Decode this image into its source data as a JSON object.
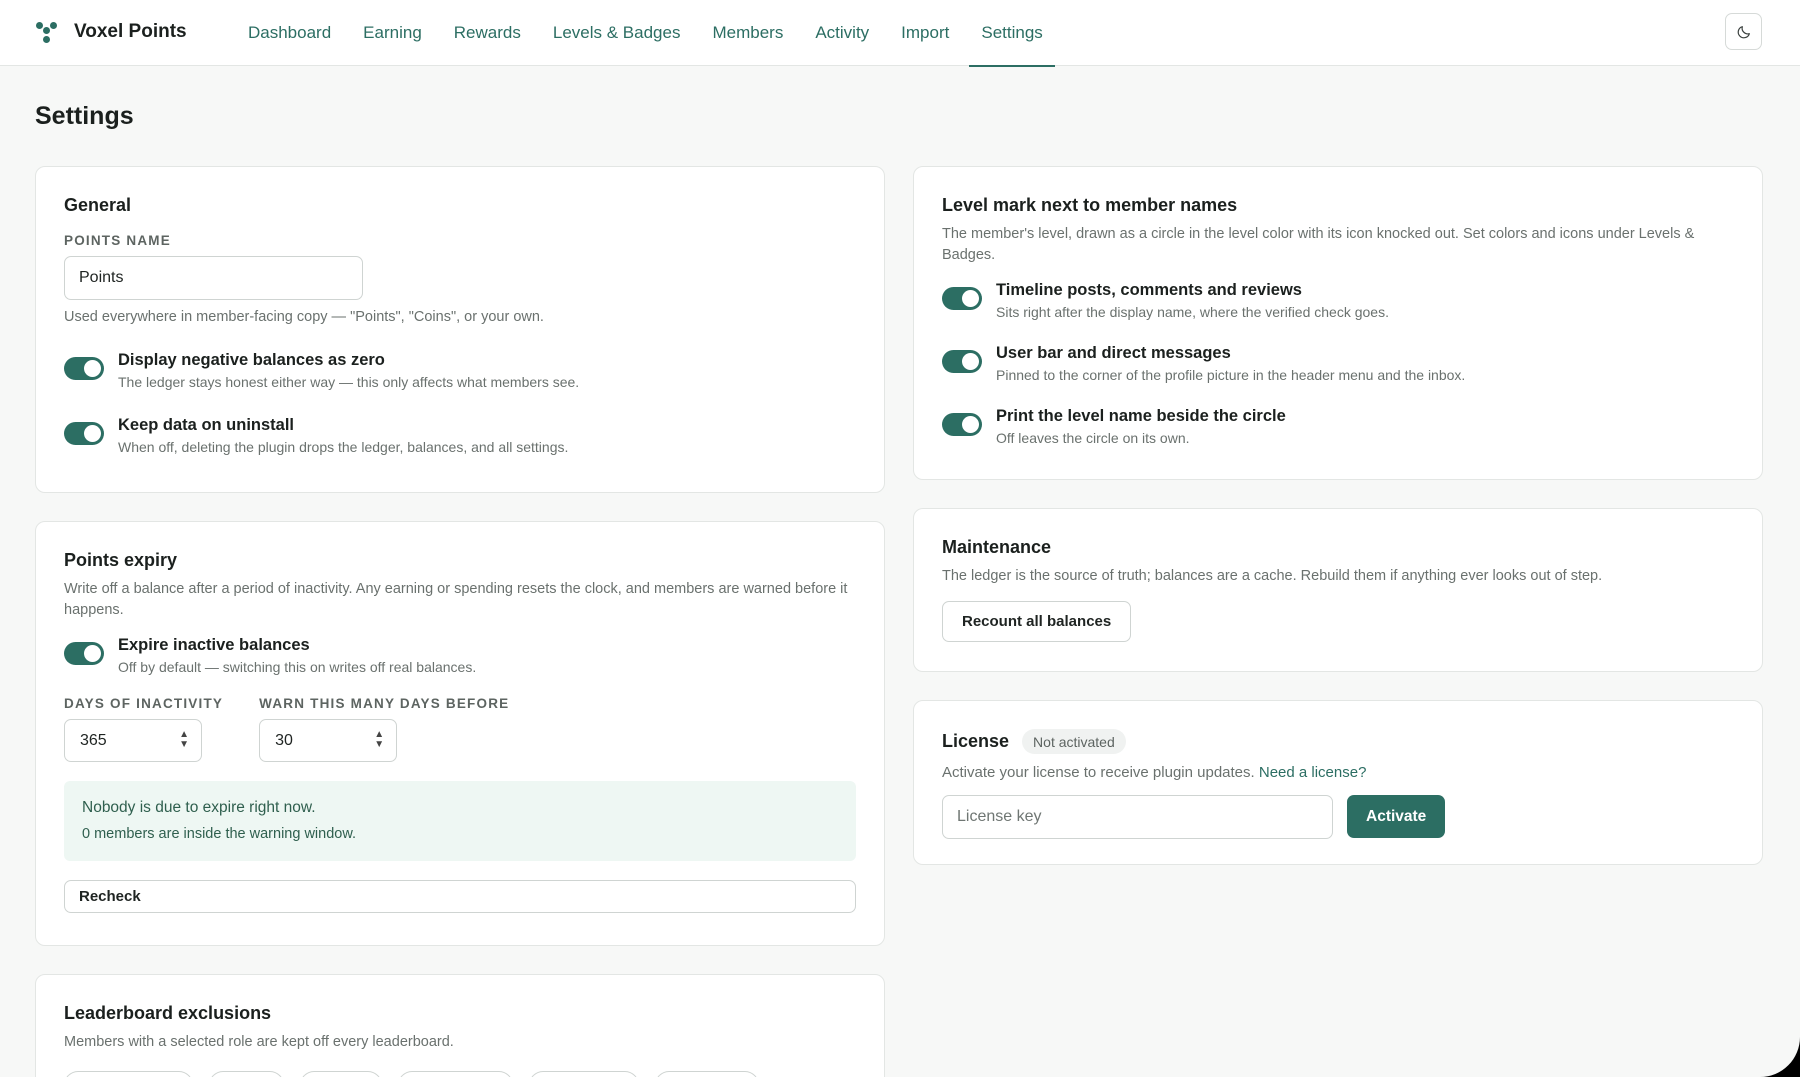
{
  "app": {
    "name": "Voxel Points"
  },
  "nav": {
    "items": [
      {
        "label": "Dashboard"
      },
      {
        "label": "Earning"
      },
      {
        "label": "Rewards"
      },
      {
        "label": "Levels & Badges"
      },
      {
        "label": "Members"
      },
      {
        "label": "Activity"
      },
      {
        "label": "Import"
      },
      {
        "label": "Settings",
        "active": true
      }
    ],
    "theme_icon": "moon-icon"
  },
  "page": {
    "title": "Settings"
  },
  "general": {
    "title": "General",
    "points_name_label": "POINTS NAME",
    "points_name_value": "Points",
    "points_name_help": "Used everywhere in member-facing copy — \"Points\", \"Coins\", or your own.",
    "toggles": [
      {
        "title": "Display negative balances as zero",
        "sub": "The ledger stays honest either way — this only affects what members see.",
        "on": true
      },
      {
        "title": "Keep data on uninstall",
        "sub": "When off, deleting the plugin drops the ledger, balances, and all settings.",
        "on": true
      }
    ]
  },
  "expiry": {
    "title": "Points expiry",
    "desc": "Write off a balance after a period of inactivity. Any earning or spending resets the clock, and members are warned before it happens.",
    "toggle": {
      "title": "Expire inactive balances",
      "sub": "Off by default — switching this on writes off real balances.",
      "on": true
    },
    "days_label": "DAYS OF INACTIVITY",
    "days_value": "365",
    "warn_label": "WARN THIS MANY DAYS BEFORE",
    "warn_value": "30",
    "notice_title": "Nobody is due to expire right now.",
    "notice_sub": "0 members are inside the warning window.",
    "recheck_label": "Recheck"
  },
  "leaderboard": {
    "title": "Leaderboard exclusions",
    "desc": "Members with a selected role are kept off every leaderboard."
  },
  "level_mark": {
    "title": "Level mark next to member names",
    "desc": "The member's level, drawn as a circle in the level color with its icon knocked out. Set colors and icons under Levels & Badges.",
    "toggles": [
      {
        "title": "Timeline posts, comments and reviews",
        "sub": "Sits right after the display name, where the verified check goes.",
        "on": true
      },
      {
        "title": "User bar and direct messages",
        "sub": "Pinned to the corner of the profile picture in the header menu and the inbox.",
        "on": true
      },
      {
        "title": "Print the level name beside the circle",
        "sub": "Off leaves the circle on its own.",
        "on": true
      }
    ]
  },
  "maintenance": {
    "title": "Maintenance",
    "desc": "The ledger is the source of truth; balances are a cache. Rebuild them if anything ever looks out of step.",
    "button_label": "Recount all balances"
  },
  "license": {
    "title": "License",
    "status": "Not activated",
    "desc": "Activate your license to receive plugin updates.",
    "link_label": "Need a license?",
    "input_placeholder": "License key",
    "button_label": "Activate"
  },
  "colors": {
    "accent": "#2c6e63",
    "notice_bg": "#eef7f3"
  }
}
